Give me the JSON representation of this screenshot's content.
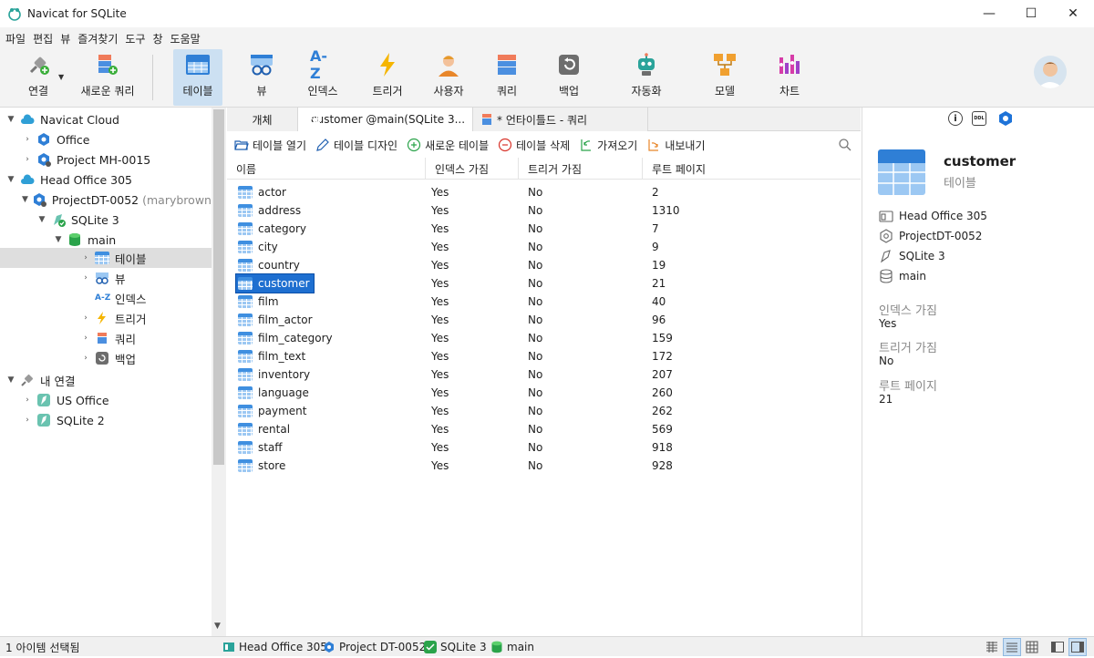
{
  "window": {
    "title": "Navicat for SQLite",
    "minimize": "—",
    "maximize": "☐",
    "close": "✕"
  },
  "menu": [
    "파일",
    "편집",
    "뷰",
    "즐겨찾기",
    "도구",
    "창",
    "도움말"
  ],
  "toolbar": {
    "connect": "연결",
    "new_query": "새로운 쿼리",
    "table": "테이블",
    "view": "뷰",
    "index": "인덱스",
    "trigger": "트리거",
    "user": "사용자",
    "query": "쿼리",
    "backup": "백업",
    "automation": "자동화",
    "model": "모델",
    "chart": "차트",
    "index_glyph": "A-Z"
  },
  "tree": {
    "navicat_cloud": "Navicat Cloud",
    "office": "Office",
    "project_mh": "Project MH-0015",
    "head_office": "Head Office 305",
    "project_dt": "ProjectDT-0052",
    "project_dt_user": "(marybrown@",
    "sqlite3": "SQLite 3",
    "main": "main",
    "tables": "테이블",
    "views": "뷰",
    "indexes": "인덱스",
    "triggers": "트리거",
    "queries": "쿼리",
    "backups": "백업",
    "my_connections": "내 연결",
    "us_office": "US Office",
    "sqlite2": "SQLite 2",
    "index_glyph": "A-Z"
  },
  "tabs": {
    "objects": "개체",
    "customer_tab": "customer @main(SQLite 3...",
    "query_tab": "* 언타이틀드 - 쿼리"
  },
  "objbar": {
    "open": "테이블 열기",
    "design": "테이블 디자인",
    "new": "새로운 테이블",
    "delete": "테이블 삭제",
    "import": "가져오기",
    "export": "내보내기"
  },
  "grid": {
    "headers": {
      "name": "이름",
      "has_index": "인덱스 가짐",
      "has_trigger": "트리거 가짐",
      "root_page": "루트 페이지"
    },
    "rows": [
      {
        "name": "actor",
        "idx": "Yes",
        "trg": "No",
        "rp": "2"
      },
      {
        "name": "address",
        "idx": "Yes",
        "trg": "No",
        "rp": "1310"
      },
      {
        "name": "category",
        "idx": "Yes",
        "trg": "No",
        "rp": "7"
      },
      {
        "name": "city",
        "idx": "Yes",
        "trg": "No",
        "rp": "9"
      },
      {
        "name": "country",
        "idx": "Yes",
        "trg": "No",
        "rp": "19"
      },
      {
        "name": "customer",
        "idx": "Yes",
        "trg": "No",
        "rp": "21"
      },
      {
        "name": "film",
        "idx": "Yes",
        "trg": "No",
        "rp": "40"
      },
      {
        "name": "film_actor",
        "idx": "Yes",
        "trg": "No",
        "rp": "96"
      },
      {
        "name": "film_category",
        "idx": "Yes",
        "trg": "No",
        "rp": "159"
      },
      {
        "name": "film_text",
        "idx": "Yes",
        "trg": "No",
        "rp": "172"
      },
      {
        "name": "inventory",
        "idx": "Yes",
        "trg": "No",
        "rp": "207"
      },
      {
        "name": "language",
        "idx": "Yes",
        "trg": "No",
        "rp": "260"
      },
      {
        "name": "payment",
        "idx": "Yes",
        "trg": "No",
        "rp": "262"
      },
      {
        "name": "rental",
        "idx": "Yes",
        "trg": "No",
        "rp": "569"
      },
      {
        "name": "staff",
        "idx": "Yes",
        "trg": "No",
        "rp": "918"
      },
      {
        "name": "store",
        "idx": "Yes",
        "trg": "No",
        "rp": "928"
      }
    ],
    "selected": "customer"
  },
  "panel": {
    "name": "customer",
    "type": "테이블",
    "connection": "Head Office 305",
    "project": "ProjectDT-0052",
    "database": "SQLite 3",
    "schema": "main",
    "has_index_label": "인덱스 가짐",
    "has_index_value": "Yes",
    "has_trigger_label": "트리거 가짐",
    "has_trigger_value": "No",
    "root_page_label": "루트 페이지",
    "root_page_value": "21",
    "info_glyph": "i",
    "ddl_glyph": "DDL"
  },
  "status": {
    "selection": "1 아이템 선택됨",
    "connection": "Head Office 305",
    "project": "Project DT-0052",
    "database": "SQLite 3",
    "schema": "main"
  }
}
